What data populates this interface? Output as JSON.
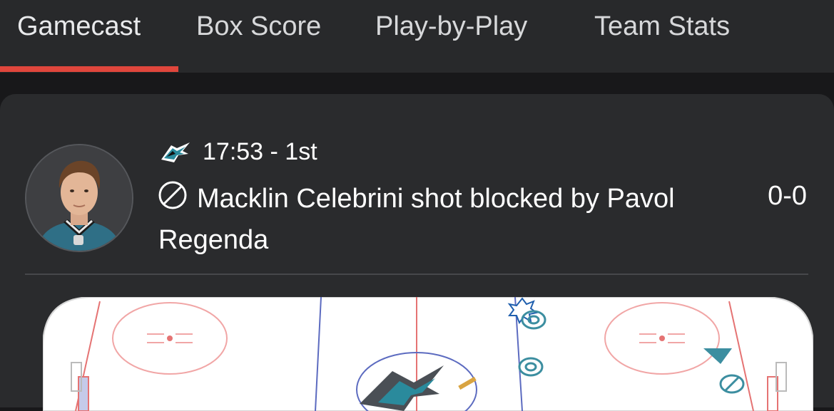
{
  "tabs": [
    {
      "label": "Gamecast",
      "active": true
    },
    {
      "label": "Box Score",
      "active": false
    },
    {
      "label": "Play-by-Play",
      "active": false
    },
    {
      "label": "Team Stats",
      "active": false
    }
  ],
  "accent_color": "#e0463c",
  "play": {
    "team_icon": "sharks-logo-icon",
    "time": "17:53 - 1st",
    "event_icon": "blocked-shot-icon",
    "description": "Macklin Celebrini shot blocked by Pavol Regenda",
    "score": "0-0"
  },
  "rink": {
    "event_marker": "blocked-shot-marker"
  }
}
